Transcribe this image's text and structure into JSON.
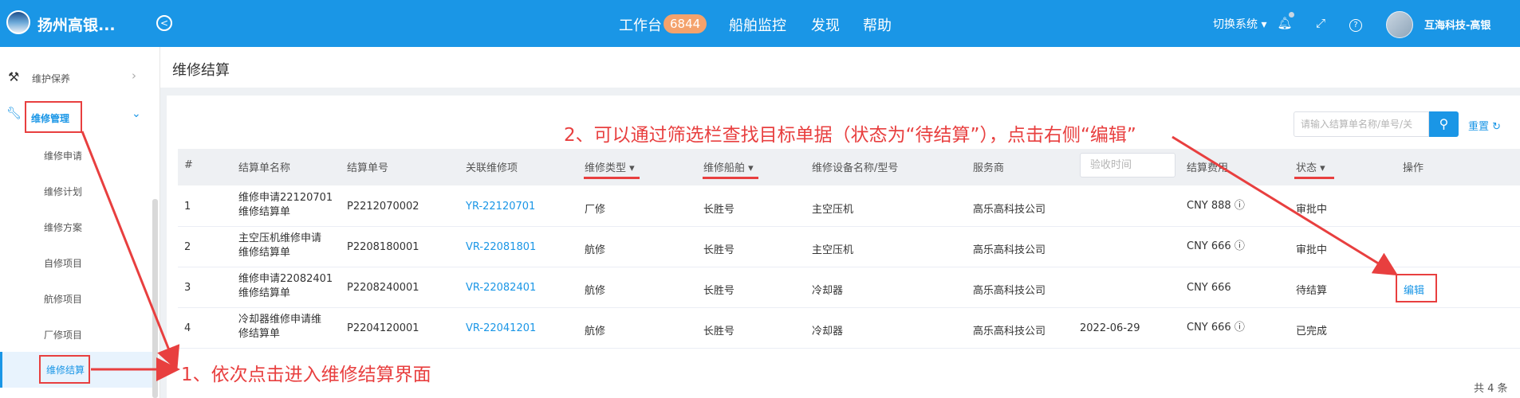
{
  "header": {
    "app_title": "扬州高银...",
    "nav": [
      {
        "label": "工作台",
        "badge": "6844"
      },
      {
        "label": "船舶监控"
      },
      {
        "label": "发现"
      },
      {
        "label": "帮助"
      }
    ],
    "switch_system": "切换系统",
    "user_name": "互海科技-高银",
    "icons": [
      "bell-icon",
      "fullscreen-icon",
      "help-icon"
    ]
  },
  "sidebar": {
    "maintain": "维护保养",
    "repair_manage": "维修管理",
    "sub_items": [
      "维修申请",
      "维修计划",
      "维修方案",
      "自修项目",
      "航修项目",
      "厂修项目",
      "维修结算"
    ],
    "active": "维修结算"
  },
  "page": {
    "title": "维修结算"
  },
  "toolbar": {
    "search_placeholder": "请输入结算单名称/单号/关",
    "reset": "重置"
  },
  "table": {
    "headers": [
      "#",
      "结算单名称",
      "结算单号",
      "关联维修项",
      "维修类型",
      "维修船舶",
      "维修设备名称/型号",
      "服务商",
      "验收时间",
      "结算费用",
      "状态",
      "操作"
    ],
    "rows": [
      {
        "no": "1",
        "name_l1": "维修申请22120701",
        "name_l2": "维修结算单",
        "code": "P2212070002",
        "item": "YR-22120701",
        "type": "厂修",
        "ship": "长胜号",
        "device": "主空压机",
        "vendor": "高乐高科技公司",
        "date": "",
        "fee": "CNY 888",
        "status": "审批中",
        "op": ""
      },
      {
        "no": "2",
        "name_l1": "主空压机维修申请",
        "name_l2": "维修结算单",
        "code": "P2208180001",
        "item": "VR-22081801",
        "type": "航修",
        "ship": "长胜号",
        "device": "主空压机",
        "vendor": "高乐高科技公司",
        "date": "",
        "fee": "CNY 666",
        "status": "审批中",
        "op": ""
      },
      {
        "no": "3",
        "name_l1": "维修申请22082401",
        "name_l2": "维修结算单",
        "code": "P2208240001",
        "item": "VR-22082401",
        "type": "航修",
        "ship": "长胜号",
        "device": "冷却器",
        "vendor": "高乐高科技公司",
        "date": "",
        "fee": "CNY 666",
        "status": "待结算",
        "op": "编辑"
      },
      {
        "no": "4",
        "name_l1": "冷却器维修申请维",
        "name_l2": "修结算单",
        "code": "P2204120001",
        "item": "VR-22041201",
        "type": "航修",
        "ship": "长胜号",
        "device": "冷却器",
        "vendor": "高乐高科技公司",
        "date": "2022-06-29",
        "fee": "CNY 666",
        "status": "已完成",
        "op": ""
      }
    ],
    "total": "共 4 条"
  },
  "annotations": {
    "step1": "1、依次点击进入维修结算界面",
    "step2": "2、可以通过筛选栏查找目标单据（状态为“待结算”），点击右侧“编辑”"
  },
  "colors": {
    "primary": "#1a96e6",
    "annotation": "#e83f3f",
    "badge": "#f4a26c"
  }
}
